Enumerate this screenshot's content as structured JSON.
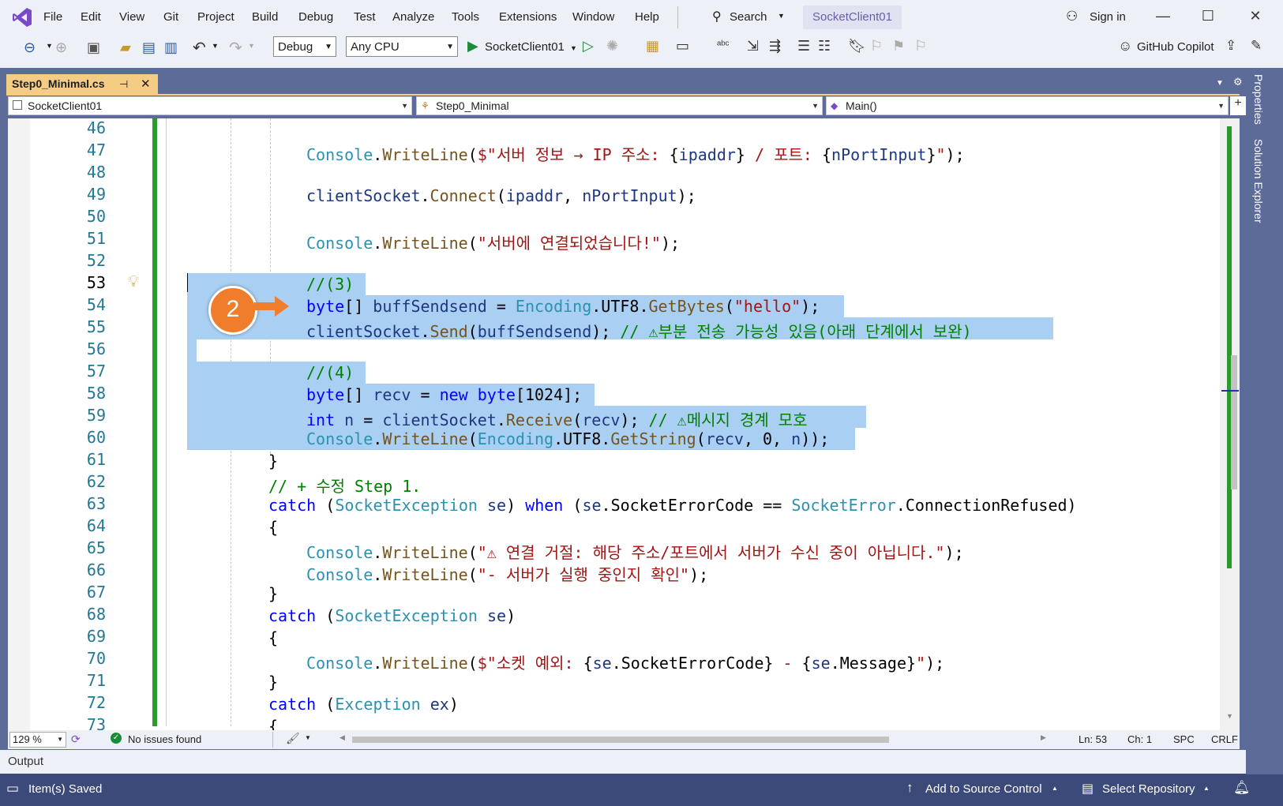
{
  "menubar": {
    "items": [
      "File",
      "Edit",
      "View",
      "Git",
      "Project",
      "Build",
      "Debug",
      "Test",
      "Analyze",
      "Tools",
      "Extensions",
      "Window",
      "Help"
    ],
    "search_label": "Search",
    "solution_name": "SocketClient01",
    "sign_in": "Sign in"
  },
  "toolbar": {
    "config": "Debug",
    "platform": "Any CPU",
    "start_target": "SocketClient01",
    "copilot": "GitHub Copilot"
  },
  "doc_tab": {
    "label": "Step0_Minimal.cs"
  },
  "navbar": {
    "project": "SocketClient01",
    "class": "Step0_Minimal",
    "member": "Main()"
  },
  "callout": {
    "number": "2"
  },
  "code": {
    "line_numbers": [
      "46",
      "47",
      "48",
      "49",
      "50",
      "51",
      "52",
      "53",
      "54",
      "55",
      "56",
      "57",
      "58",
      "59",
      "60",
      "61",
      "62",
      "63",
      "64",
      "65",
      "66",
      "67",
      "68",
      "69",
      "70",
      "71",
      "72",
      "73"
    ],
    "current_line": "53"
  },
  "editor_status": {
    "zoom": "129 %",
    "issues": "No issues found",
    "line": "Ln: 53",
    "col": "Ch: 1",
    "spacing": "SPC",
    "eol": "CRLF"
  },
  "output_tab": "Output",
  "statusbar": {
    "message": "Item(s) Saved",
    "source_control": "Add to Source Control",
    "repository": "Select Repository"
  },
  "side_panel": {
    "properties": "Properties",
    "solution_explorer": "Solution Explorer"
  }
}
